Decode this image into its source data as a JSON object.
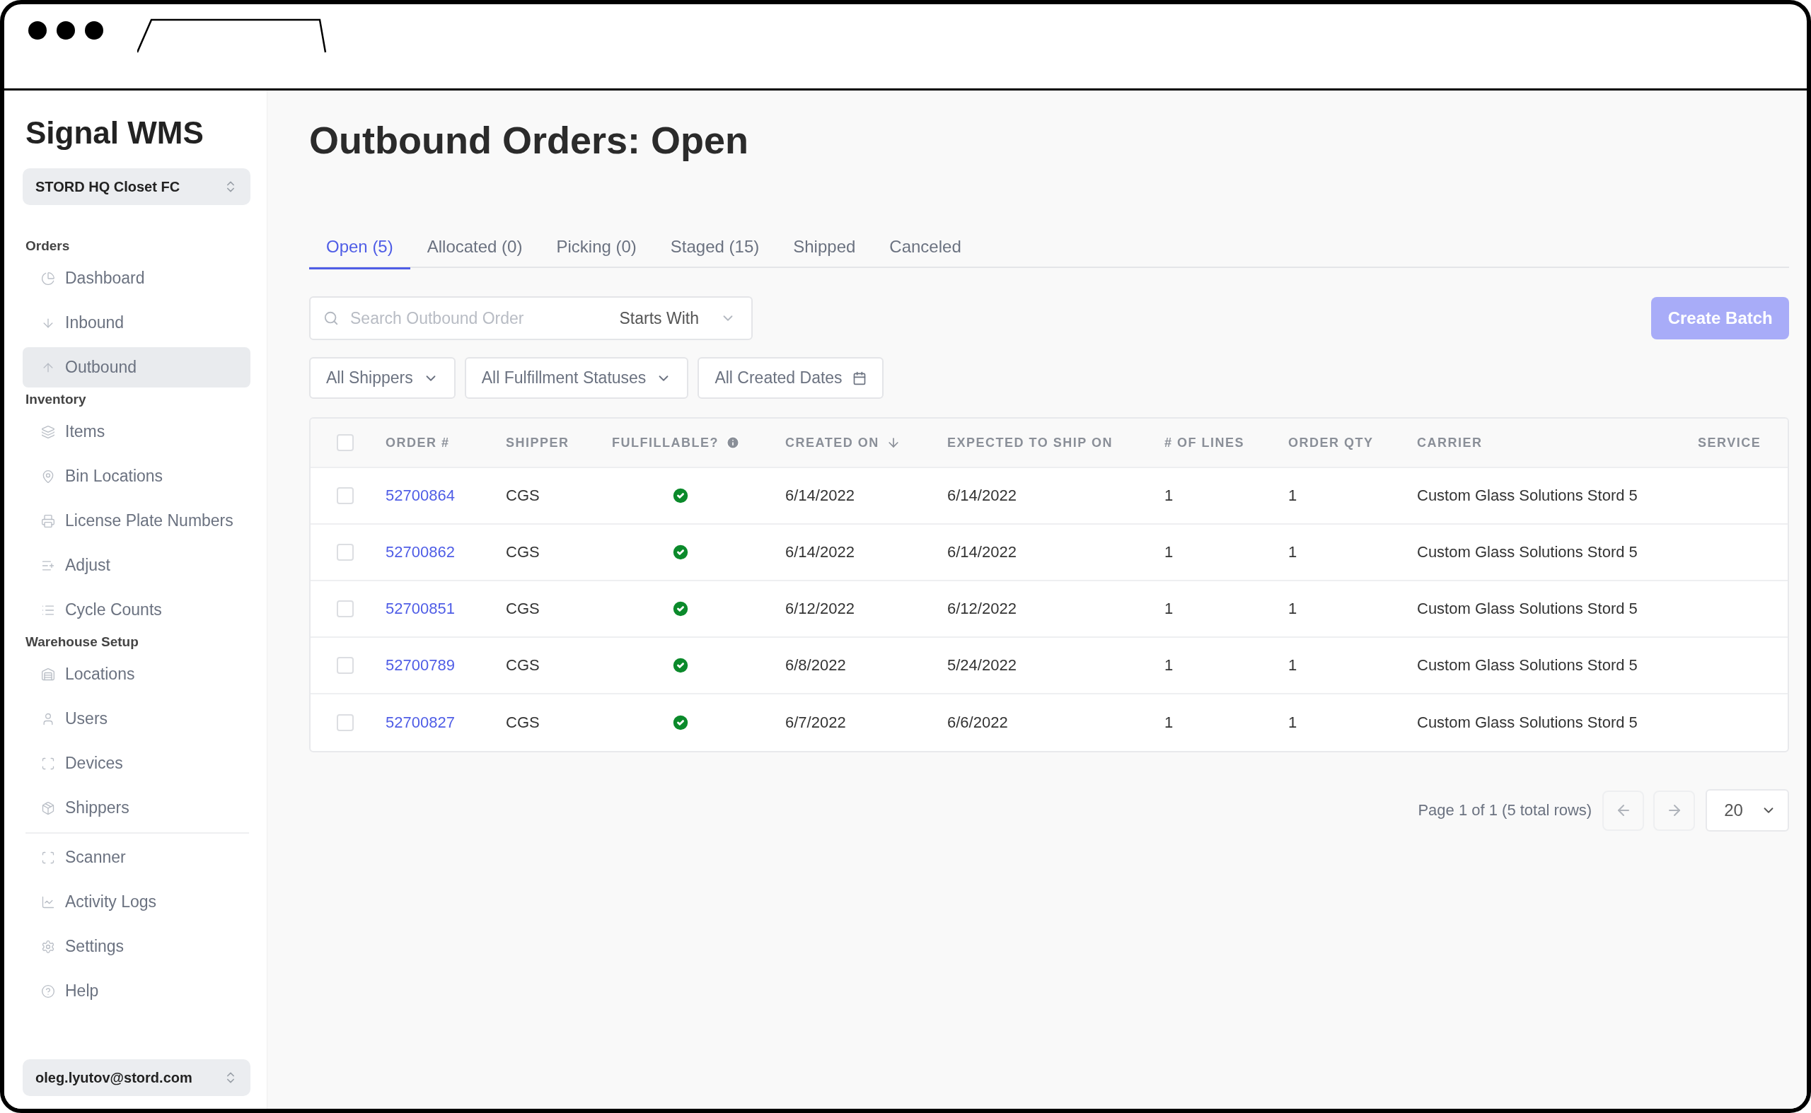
{
  "app": {
    "title": "Signal WMS",
    "facility": "STORD HQ Closet FC",
    "user": "oleg.lyutov@stord.com"
  },
  "sidebar": {
    "sections": [
      {
        "heading": "Orders",
        "items": [
          {
            "label": "Dashboard",
            "selected": false
          },
          {
            "label": "Inbound",
            "selected": false
          },
          {
            "label": "Outbound",
            "selected": true
          }
        ]
      },
      {
        "heading": "Inventory",
        "items": [
          {
            "label": "Items",
            "selected": false
          },
          {
            "label": "Bin Locations",
            "selected": false
          },
          {
            "label": "License Plate Numbers",
            "selected": false
          },
          {
            "label": "Adjust",
            "selected": false
          },
          {
            "label": "Cycle Counts",
            "selected": false
          }
        ]
      },
      {
        "heading": "Warehouse Setup",
        "items": [
          {
            "label": "Locations",
            "selected": false
          },
          {
            "label": "Users",
            "selected": false
          },
          {
            "label": "Devices",
            "selected": false
          },
          {
            "label": "Shippers",
            "selected": false
          }
        ]
      },
      {
        "items": [
          {
            "label": "Scanner",
            "selected": false
          },
          {
            "label": "Activity Logs",
            "selected": false
          },
          {
            "label": "Settings",
            "selected": false
          },
          {
            "label": "Help",
            "selected": false
          }
        ]
      }
    ]
  },
  "page": {
    "title": "Outbound Orders: Open"
  },
  "tabs": [
    {
      "label": "Open (5)",
      "selected": true
    },
    {
      "label": "Allocated (0)",
      "selected": false
    },
    {
      "label": "Picking (0)",
      "selected": false
    },
    {
      "label": "Staged (15)",
      "selected": false
    },
    {
      "label": "Shipped",
      "selected": false
    },
    {
      "label": "Canceled",
      "selected": false
    }
  ],
  "search": {
    "placeholder": "Search Outbound Order",
    "mode": "Starts With"
  },
  "create_batch": {
    "label": "Create Batch",
    "disabled": true
  },
  "filters": [
    {
      "label": "All Shippers",
      "kind": "dropdown"
    },
    {
      "label": "All Fulfillment Statuses",
      "kind": "dropdown"
    },
    {
      "label": "All Created Dates",
      "kind": "date"
    }
  ],
  "table": {
    "header_checked": false,
    "columns": [
      {
        "label": "ORDER #"
      },
      {
        "label": "SHIPPER"
      },
      {
        "label": "FULFILLABLE?",
        "info": true
      },
      {
        "label": "CREATED ON",
        "sort_descending": true
      },
      {
        "label": "EXPECTED TO SHIP ON"
      },
      {
        "label": "# OF LINES"
      },
      {
        "label": "ORDER QTY"
      },
      {
        "label": "CARRIER"
      },
      {
        "label": "SERVICE"
      }
    ],
    "rows": [
      {
        "checked": false,
        "order": "52700864",
        "shipper": "CGS",
        "fulfillable": true,
        "created": "6/14/2022",
        "expected": "6/14/2022",
        "lines": "1",
        "qty": "1",
        "carrier": "Custom Glass Solutions Stord 5"
      },
      {
        "checked": false,
        "order": "52700862",
        "shipper": "CGS",
        "fulfillable": true,
        "created": "6/14/2022",
        "expected": "6/14/2022",
        "lines": "1",
        "qty": "1",
        "carrier": "Custom Glass Solutions Stord 5"
      },
      {
        "checked": false,
        "order": "52700851",
        "shipper": "CGS",
        "fulfillable": true,
        "created": "6/12/2022",
        "expected": "6/12/2022",
        "lines": "1",
        "qty": "1",
        "carrier": "Custom Glass Solutions Stord 5"
      },
      {
        "checked": false,
        "order": "52700789",
        "shipper": "CGS",
        "fulfillable": true,
        "created": "6/8/2022",
        "expected": "5/24/2022",
        "lines": "1",
        "qty": "1",
        "carrier": "Custom Glass Solutions Stord 5"
      },
      {
        "checked": false,
        "order": "52700827",
        "shipper": "CGS",
        "fulfillable": true,
        "created": "6/7/2022",
        "expected": "6/6/2022",
        "lines": "1",
        "qty": "1",
        "carrier": "Custom Glass Solutions Stord 5"
      }
    ]
  },
  "pagination": {
    "summary": "Page 1 of 1 (5 total rows)",
    "prev_disabled": true,
    "next_disabled": true,
    "page_size": "20"
  }
}
